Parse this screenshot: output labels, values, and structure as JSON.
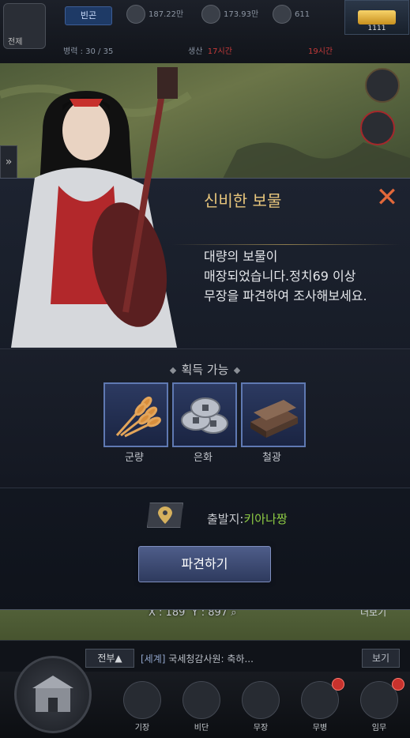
{
  "topbar": {
    "city_label": "전제",
    "mode_tag": "빈곤",
    "resources": [
      {
        "name": "food",
        "value": "187.22만"
      },
      {
        "name": "silver",
        "value": "173.93만"
      },
      {
        "name": "iron",
        "value": "611"
      }
    ],
    "gold_value": "1111",
    "troop_label": "병력 : 30 / 35",
    "timer1_label": "생산",
    "timer1_value": "17시간",
    "timer2_value": "19시간"
  },
  "dialog": {
    "title": "신비한 보물",
    "close_symbol": "✕",
    "description": [
      "대량의 보물이",
      "매장되었습니다.정치69 이상",
      "무장을 파견하여 조사해보세요."
    ],
    "rewards_title": "획득 가능",
    "rewards": [
      {
        "label": "군량",
        "icon": "wheat-icon"
      },
      {
        "label": "은화",
        "icon": "silver-coins-icon"
      },
      {
        "label": "철광",
        "icon": "iron-ingot-icon"
      }
    ],
    "departure_label": "출발지:",
    "departure_value": "키아나짱",
    "dispatch_button": "파견하기"
  },
  "map": {
    "coord_x": "X : 189",
    "coord_y": "Y : 897",
    "more_label": "더보기"
  },
  "chat": {
    "tab_label": "전부▲",
    "channel": "[세계]",
    "message": "국세청감사원: 축하...",
    "send_label": "보기"
  },
  "nav": {
    "items": [
      "기장",
      "비단",
      "무장",
      "무병",
      "임무"
    ]
  },
  "colors": {
    "title_gold": "#e8c67c",
    "close_orange": "#e2683a",
    "departure_green": "#8ecb44",
    "reward_frame_blue": "#5f79b2"
  }
}
